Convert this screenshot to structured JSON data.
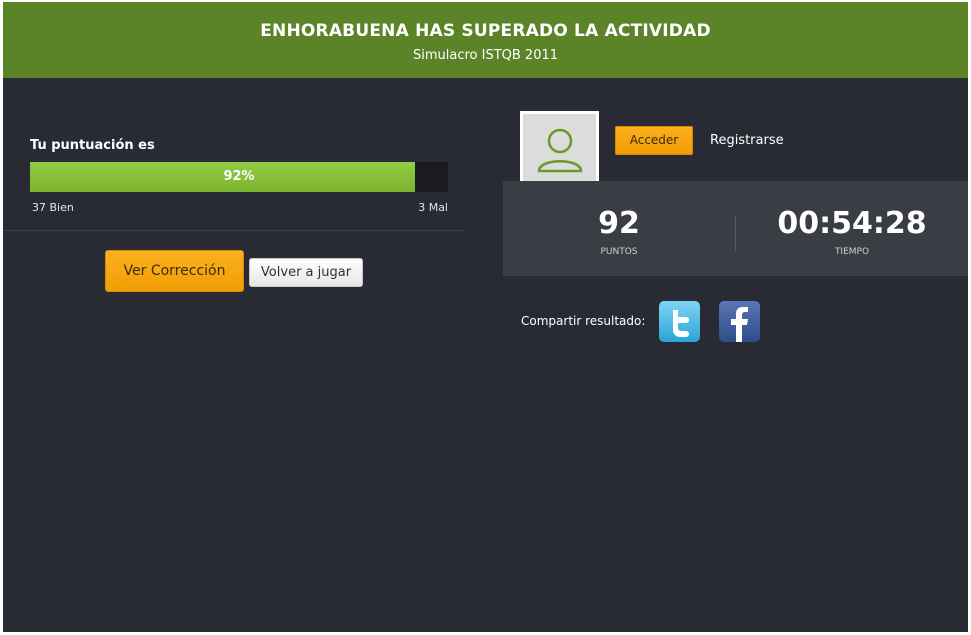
{
  "header": {
    "title": "ENHORABUENA HAS SUPERADO LA ACTIVIDAD",
    "subtitle": "Simulacro ISTQB 2011"
  },
  "score": {
    "label": "Tu puntuación es",
    "percent_text": "92%",
    "percent_value": 92,
    "good_label": "37 Bien",
    "bad_label": "3 Mal"
  },
  "actions": {
    "correction_label": "Ver Corrección",
    "replay_label": "Volver a jugar"
  },
  "user": {
    "login_label": "Acceder",
    "register_label": "Registrarse"
  },
  "stats": {
    "points_value": "92",
    "points_label": "PUNTOS",
    "time_value": "00:54:28",
    "time_label": "TIEMPO"
  },
  "share": {
    "label": "Compartir resultado:",
    "networks": [
      "twitter-icon",
      "facebook-icon"
    ]
  },
  "colors": {
    "header_bg": "#5b8429",
    "panel_bg": "#282b33",
    "accent_orange": "#f29d05",
    "progress_green": "#7cb32f"
  }
}
